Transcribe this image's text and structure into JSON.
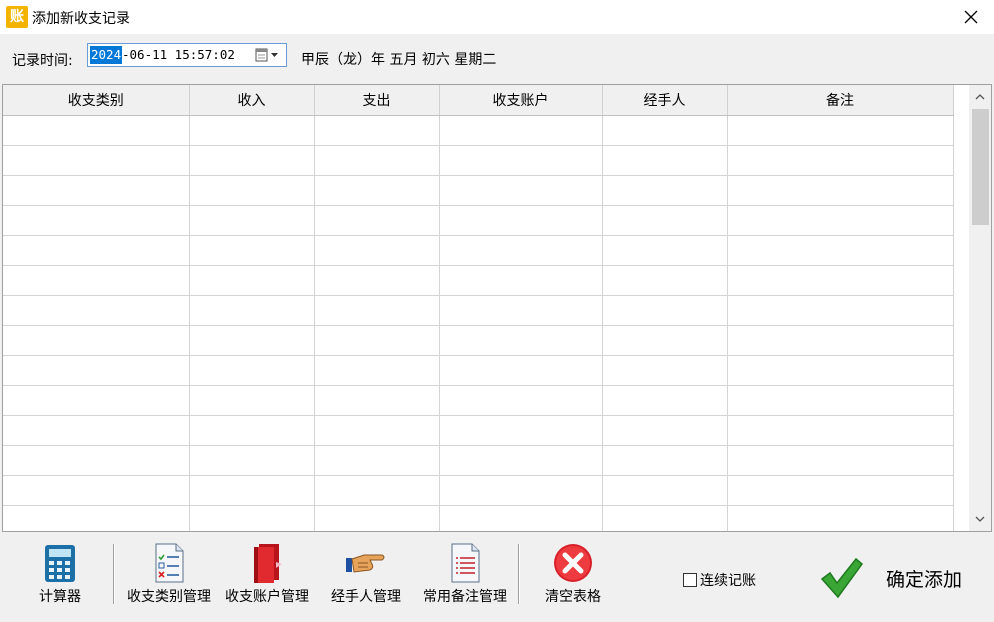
{
  "window": {
    "title": "添加新收支记录",
    "app_icon_char": "账"
  },
  "time": {
    "label": "记录时间:",
    "year": "2024",
    "rest": "-06-11 15:57:02",
    "lunar": "甲辰（龙）年 五月 初六 星期二"
  },
  "table": {
    "columns": [
      "收支类别",
      "收入",
      "支出",
      "收支账户",
      "经手人",
      "备注"
    ]
  },
  "toolbar": {
    "calculator": "计算器",
    "category_mgmt": "收支类别管理",
    "account_mgmt": "收支账户管理",
    "handler_mgmt": "经手人管理",
    "note_mgmt": "常用备注管理",
    "clear_table": "清空表格",
    "continuous": "连续记账",
    "confirm": "确定添加"
  },
  "colors": {
    "accent": "#0078d7",
    "confirm_green": "#3aa635",
    "clear_red": "#e02020"
  }
}
